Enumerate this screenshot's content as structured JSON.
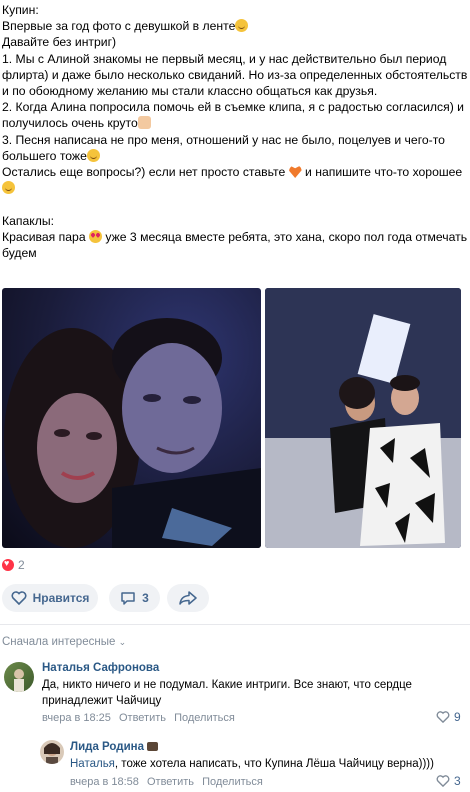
{
  "post": {
    "lines": [
      "Купин:",
      "Впервые за год фото с девушкой в ленте",
      "Давайте без интриг)",
      "1. Мы с Алиной знакомы не первый месяц, и у нас действительно был период",
      "флирта) и даже было несколько свиданий. Но из-за определенных обстоятельств",
      "и по обоюдному желанию мы стали классно общаться как друзья.",
      "2. Когда Алина попросила помочь ей в съемке клипа, я с радостью согласился) и",
      "получилось очень круто",
      "3. Песня написана не про меня, отношений у нас не было, поцелуев и чего-то",
      "большего тоже",
      "Остались еще вопросы?) если нет просто ставьте",
      "и напишите что-то хорошее",
      "",
      "",
      "Капаклы:",
      "Красивая пара",
      "уже 3 месяца вместе ребята, это хана, скоро пол года отмечать",
      "будем"
    ]
  },
  "reactions": {
    "count": "2"
  },
  "actions": {
    "like_label": "Нравится",
    "comment_count": "3"
  },
  "comments_sort": "Сначала интересные",
  "comments": [
    {
      "author": "Наталья Сафронова",
      "text_line1": "Да, никто ничего и не подумал. Какие интриги. Все знают, что сердце",
      "text_line2": "принадлежит Чайчицу",
      "time": "вчера в 18:25",
      "reply": "Ответить",
      "share": "Поделиться",
      "likes": "9"
    },
    {
      "author": "Лида Родина",
      "mention": "Наталья",
      "text": ", тоже хотела написать, что Купина Лёша Чайчицу верна))))",
      "time": "вчера в 18:58",
      "reply": "Ответить",
      "share": "Поделиться",
      "likes": "3"
    }
  ],
  "colors": {
    "link": "#2a5885",
    "meta": "#818c99",
    "button_bg": "#f0f2f5",
    "heart": "#ff3347"
  },
  "icons": [
    "smile-emoji-icon",
    "thumbs-up-icon",
    "heart-eyes-emoji-icon",
    "orange-heart-icon",
    "heart-icon",
    "comment-icon",
    "share-icon",
    "chevron-down-icon"
  ]
}
